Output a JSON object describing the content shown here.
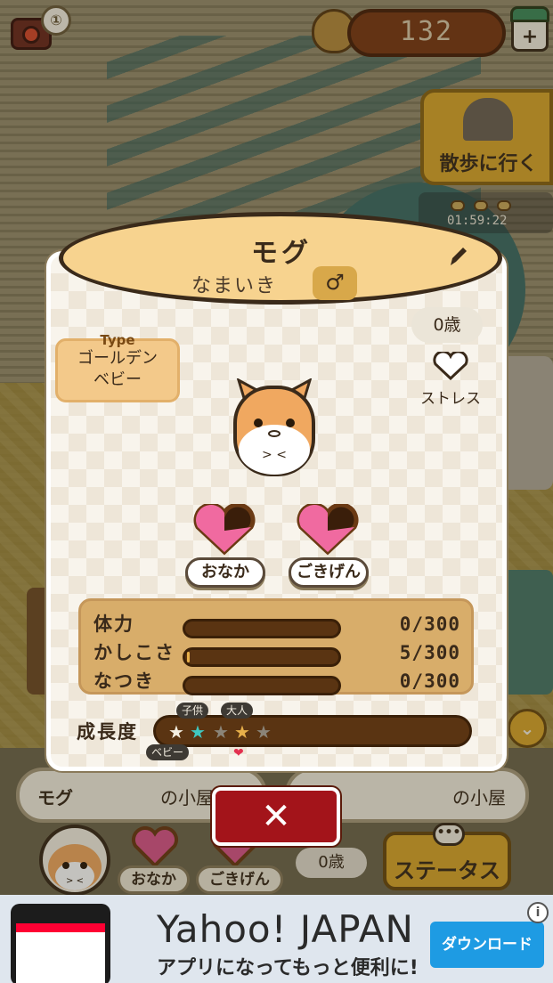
{
  "hud": {
    "coins": "132",
    "walk_label": "散歩に行く",
    "timer": "01:59:22"
  },
  "modal": {
    "hamster_name": "モグ",
    "personality": "なまいき",
    "sex_symbol": "♂",
    "type_heading": "Type",
    "type_line1": "ゴールデン",
    "type_line2": "ベビー",
    "age": "0歳",
    "stress_label": "ストレス",
    "mood": [
      {
        "label": "おなか",
        "level": 0.7
      },
      {
        "label": "ごきげん",
        "level": 0.7
      }
    ],
    "stats": [
      {
        "label": "体力",
        "value": "0/300",
        "fraction": 0.0
      },
      {
        "label": "かしこさ",
        "value": "5/300",
        "fraction": 0.017
      },
      {
        "label": "なつき",
        "value": "0/300",
        "fraction": 0.0
      }
    ],
    "growth": {
      "label": "成長度",
      "stages": [
        "ベビー",
        "子供",
        "大人"
      ],
      "stars_total": 5,
      "close_symbol": "✕"
    }
  },
  "under": {
    "name": "モグ",
    "name_suffix": "の小屋",
    "home_suffix": "の小屋",
    "hunger_label": "おなか",
    "mood_label": "ごきげん",
    "age": "0歳",
    "status_label": "ステータス",
    "status_bubble": "•••"
  },
  "ad": {
    "title": "Yahoo! JAPAN",
    "subtitle": "アプリになってもっと便利に!",
    "download_label": "ダウンロード",
    "info_symbol": "i"
  },
  "colors": {
    "banner": "#f7d38f",
    "stats_panel": "#d8ad6a",
    "close_button": "#a3141a",
    "download_button": "#1e9be3",
    "heart_pink": "#f06aa0"
  }
}
